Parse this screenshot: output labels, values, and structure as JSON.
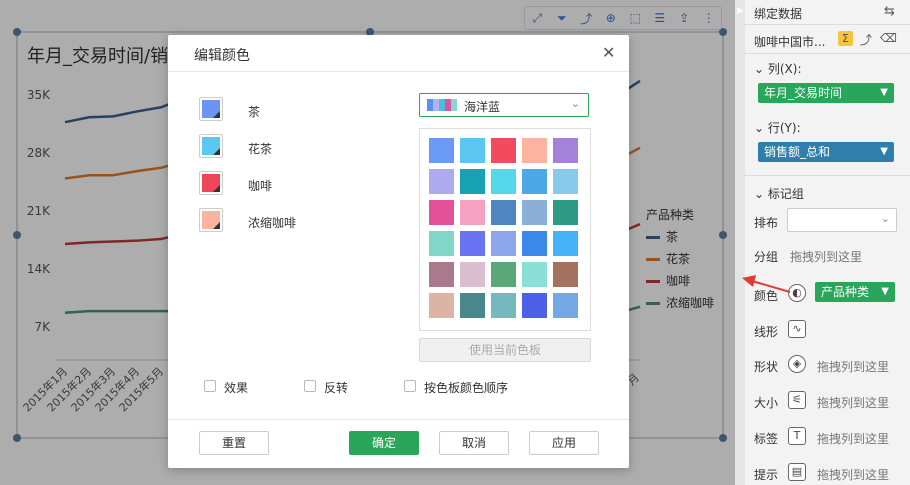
{
  "chart": {
    "title": "年月_交易时间/销",
    "toolbar_icons": [
      "fullscreen-icon",
      "filter-icon",
      "drill-icon",
      "select-icon",
      "list-icon",
      "export-icon",
      "more-icon"
    ],
    "legend_title": "产品种类",
    "legend_items": [
      {
        "name": "茶",
        "color": "#3d5f8c"
      },
      {
        "name": "花茶",
        "color": "#e07b2c"
      },
      {
        "name": "咖啡",
        "color": "#c0383b"
      },
      {
        "name": "浓缩咖啡",
        "color": "#4a8f87"
      }
    ],
    "x_tick_labels": [
      "2015年1月",
      "2015年2月",
      "2015年3月",
      "2015年4月",
      "2015年5月"
    ],
    "x_tick_label_right": "月"
  },
  "chart_data": {
    "type": "line",
    "title": "年月_交易时间/销",
    "xlabel": "",
    "ylabel": "",
    "y_tick_labels": [
      "35K",
      "28K",
      "21K",
      "14K",
      "7K"
    ],
    "y_ticks": [
      35000,
      28000,
      21000,
      14000,
      7000
    ],
    "ylim": [
      3000,
      38000
    ],
    "categories": [
      "2015年1月",
      "2015年2月",
      "2015年3月",
      "2015年4月",
      "2015年5月",
      "2015年6月"
    ],
    "series": [
      {
        "name": "茶",
        "color": "#3d5f8c",
        "values": [
          31700,
          32300,
          32400,
          33000,
          33500,
          34600
        ]
      },
      {
        "name": "花茶",
        "color": "#e07b2c",
        "values": [
          24900,
          25300,
          25300,
          25800,
          26200,
          27000
        ]
      },
      {
        "name": "咖啡",
        "color": "#c0383b",
        "values": [
          17000,
          17200,
          17300,
          17400,
          17600,
          18300
        ]
      },
      {
        "name": "浓缩咖啡",
        "color": "#4a8f87",
        "values": [
          8700,
          8900,
          8900,
          8900,
          8900,
          8900
        ]
      }
    ],
    "grid": false,
    "legend_position": "right"
  },
  "right_panel": {
    "title": "绑定数据",
    "dataset": "咖啡中国市...",
    "columns_label": "列(X):",
    "columns_field": "年月_交易时间",
    "rows_label": "行(Y):",
    "rows_field": "销售额_总和",
    "marks_label": "标记组",
    "layout_label": "排布",
    "group_label": "分组",
    "group_hint": "拖拽列到这里",
    "color_label": "颜色",
    "color_field": "产品种类",
    "line_label": "线形",
    "shape_label": "形状",
    "shape_hint": "拖拽列到这里",
    "size_label": "大小",
    "size_hint": "拖拽列到这里",
    "label_label": "标签",
    "label_hint": "拖拽列到这里",
    "tooltip_label": "提示",
    "tooltip_hint": "拖拽列到这里",
    "accent_green": "#28a65a",
    "accent_blue": "#2f7fad"
  },
  "dialog": {
    "title": "编辑颜色",
    "close_symbol": "✕",
    "series": [
      {
        "label": "茶",
        "color": "#6a94f0"
      },
      {
        "label": "花茶",
        "color": "#5ac8f0"
      },
      {
        "label": "咖啡",
        "color": "#f0465a"
      },
      {
        "label": "浓缩咖啡",
        "color": "#f8b49c"
      }
    ],
    "palette_name": "海洋蓝",
    "palette_colors": [
      "#6a9af5",
      "#5cc6f2",
      "#f24a5e",
      "#fbb49e",
      "#a482da",
      "#aeaaee",
      "#17a2b3",
      "#52d8e8",
      "#4ea8e6",
      "#88caeb",
      "#e3519a",
      "#f6a2c0",
      "#4f85c0",
      "#8bafd6",
      "#2c9a84",
      "#80d6c7",
      "#6a74f2",
      "#8ea6ec",
      "#3c88e8",
      "#46b2f8",
      "#a97a8c",
      "#dbbdd0",
      "#5aa878",
      "#8ae0d8",
      "#a57260",
      "#dcb4a6",
      "#4a878c",
      "#76b8c0",
      "#4f60e8",
      "#72a8e6"
    ],
    "use_palette_button": "使用当前色板",
    "effect_label": "效果",
    "reverse_label": "反转",
    "order_label": "按色板颜色顺序",
    "reset_button": "重置",
    "ok_button": "确定",
    "cancel_button": "取消",
    "apply_button": "应用"
  }
}
